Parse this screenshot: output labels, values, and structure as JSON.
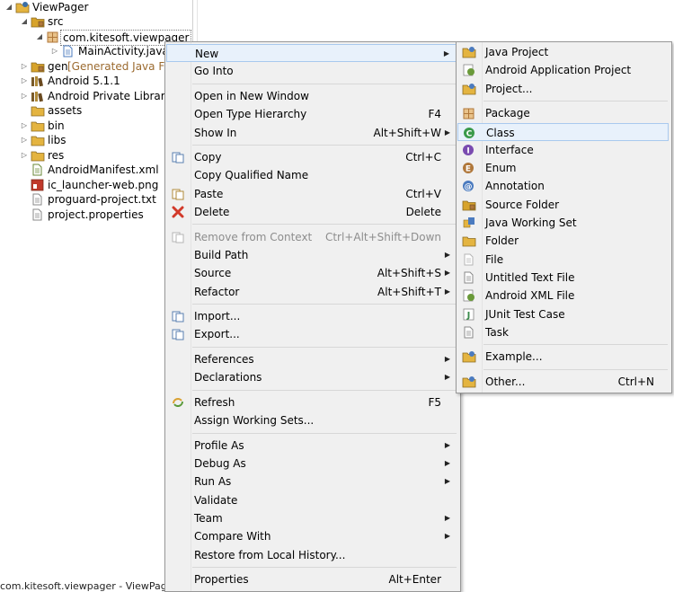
{
  "tree": {
    "rows": [
      {
        "label": "ViewPager",
        "twisty": "◢",
        "icon": "project-icon",
        "color": "#3a6ea5"
      },
      {
        "label": "src",
        "twisty": "◢",
        "icon": "source-folder-icon",
        "color": "#d7a32b"
      },
      {
        "label": "com.kitesoft.viewpager",
        "twisty": "◢",
        "icon": "package-icon",
        "color": "#b0773a"
      },
      {
        "label": "MainActivity.java",
        "twisty": "▷",
        "icon": "java-file-icon",
        "color": "#4b7bbf"
      },
      {
        "label": "gen",
        "extra": "[Generated Java Files]",
        "twisty": "▷",
        "icon": "gen-folder-icon",
        "color": "#d7a32b"
      },
      {
        "label": "Android 5.1.1",
        "twisty": "▷",
        "icon": "library-icon",
        "color": "#7a5b2a"
      },
      {
        "label": "Android Private Libraries",
        "twisty": "▷",
        "icon": "library-icon",
        "color": "#7a5b2a"
      },
      {
        "label": "assets",
        "twisty": "",
        "icon": "folder-icon",
        "color": "#e4b440"
      },
      {
        "label": "bin",
        "twisty": "▷",
        "icon": "folder-icon",
        "color": "#e4b440"
      },
      {
        "label": "libs",
        "twisty": "▷",
        "icon": "folder-icon",
        "color": "#e4b440"
      },
      {
        "label": "res",
        "twisty": "▷",
        "icon": "folder-icon",
        "color": "#e4b440"
      },
      {
        "label": "AndroidManifest.xml",
        "twisty": "",
        "icon": "xml-file-icon",
        "color": "#6a8a3a"
      },
      {
        "label": "ic_launcher-web.png",
        "twisty": "",
        "icon": "image-file-icon",
        "color": "#c0392b"
      },
      {
        "label": "proguard-project.txt",
        "twisty": "",
        "icon": "text-file-icon",
        "color": "#888888"
      },
      {
        "label": "project.properties",
        "twisty": "",
        "icon": "properties-file-icon",
        "color": "#888888"
      }
    ]
  },
  "status_bar": {
    "text": "com.kitesoft.viewpager - ViewPager/src"
  },
  "context_menu": {
    "items": [
      {
        "label": "New",
        "submenu": true,
        "highlight": true
      },
      {
        "label": "Go Into"
      },
      {
        "sep": true
      },
      {
        "label": "Open in New Window"
      },
      {
        "label": "Open Type Hierarchy",
        "shortcut": "F4"
      },
      {
        "label": "Show In",
        "shortcut": "Alt+Shift+W",
        "submenu": true
      },
      {
        "sep": true
      },
      {
        "label": "Copy",
        "shortcut": "Ctrl+C",
        "icon": "copy-icon",
        "color": "#5a7fb0"
      },
      {
        "label": "Copy Qualified Name"
      },
      {
        "label": "Paste",
        "shortcut": "Ctrl+V",
        "icon": "paste-icon",
        "color": "#b08a3a"
      },
      {
        "label": "Delete",
        "shortcut": "Delete",
        "icon": "delete-icon",
        "color": "#d23a2a"
      },
      {
        "sep": true
      },
      {
        "label": "Remove from Context",
        "shortcut": "Ctrl+Alt+Shift+Down",
        "disabled": true,
        "icon": "remove-context-icon",
        "color": "#b5b5b5"
      },
      {
        "label": "Build Path",
        "submenu": true
      },
      {
        "label": "Source",
        "shortcut": "Alt+Shift+S",
        "submenu": true
      },
      {
        "label": "Refactor",
        "shortcut": "Alt+Shift+T",
        "submenu": true
      },
      {
        "sep": true
      },
      {
        "label": "Import...",
        "icon": "import-icon",
        "color": "#5a7fb0"
      },
      {
        "label": "Export...",
        "icon": "export-icon",
        "color": "#5a7fb0"
      },
      {
        "sep": true
      },
      {
        "label": "References",
        "submenu": true
      },
      {
        "label": "Declarations",
        "submenu": true
      },
      {
        "sep": true
      },
      {
        "label": "Refresh",
        "shortcut": "F5",
        "icon": "refresh-icon",
        "color": "#d9a132"
      },
      {
        "label": "Assign Working Sets..."
      },
      {
        "sep": true
      },
      {
        "label": "Profile As",
        "submenu": true
      },
      {
        "label": "Debug As",
        "submenu": true
      },
      {
        "label": "Run As",
        "submenu": true
      },
      {
        "label": "Validate"
      },
      {
        "label": "Team",
        "submenu": true
      },
      {
        "label": "Compare With",
        "submenu": true
      },
      {
        "label": "Restore from Local History..."
      },
      {
        "sep": true
      },
      {
        "label": "Properties",
        "shortcut": "Alt+Enter"
      }
    ]
  },
  "submenu_new": {
    "items": [
      {
        "label": "Java Project",
        "icon": "java-project-icon",
        "color": "#4b7bbf"
      },
      {
        "label": "Android Application Project",
        "icon": "android-project-icon",
        "color": "#6a9a3a"
      },
      {
        "label": "Project...",
        "icon": "project-wizard-icon",
        "color": "#4b7bbf"
      },
      {
        "sep": true
      },
      {
        "label": "Package",
        "icon": "package-icon",
        "color": "#b0773a"
      },
      {
        "label": "Class",
        "icon": "class-icon",
        "color": "#3a9a4a",
        "highlight": true
      },
      {
        "label": "Interface",
        "icon": "interface-icon",
        "color": "#7a4bb0"
      },
      {
        "label": "Enum",
        "icon": "enum-icon",
        "color": "#b0773a"
      },
      {
        "label": "Annotation",
        "icon": "annotation-icon",
        "color": "#4b7bbf"
      },
      {
        "label": "Source Folder",
        "icon": "source-folder-icon",
        "color": "#d7a32b"
      },
      {
        "label": "Java Working Set",
        "icon": "working-set-icon",
        "color": "#4b7bbf"
      },
      {
        "label": "Folder",
        "icon": "folder-icon",
        "color": "#e4b440"
      },
      {
        "label": "File",
        "icon": "file-icon",
        "color": "#b5b5b5"
      },
      {
        "label": "Untitled Text File",
        "icon": "text-file-icon",
        "color": "#888888"
      },
      {
        "label": "Android XML File",
        "icon": "android-xml-icon",
        "color": "#6a9a3a"
      },
      {
        "label": "JUnit Test Case",
        "icon": "junit-icon",
        "color": "#3a8a4a"
      },
      {
        "label": "Task",
        "icon": "task-icon",
        "color": "#888888"
      },
      {
        "sep": true
      },
      {
        "label": "Example...",
        "icon": "example-icon",
        "color": "#4b7bbf"
      },
      {
        "sep": true
      },
      {
        "label": "Other...",
        "shortcut": "Ctrl+N",
        "icon": "other-icon",
        "color": "#4b7bbf"
      }
    ]
  }
}
